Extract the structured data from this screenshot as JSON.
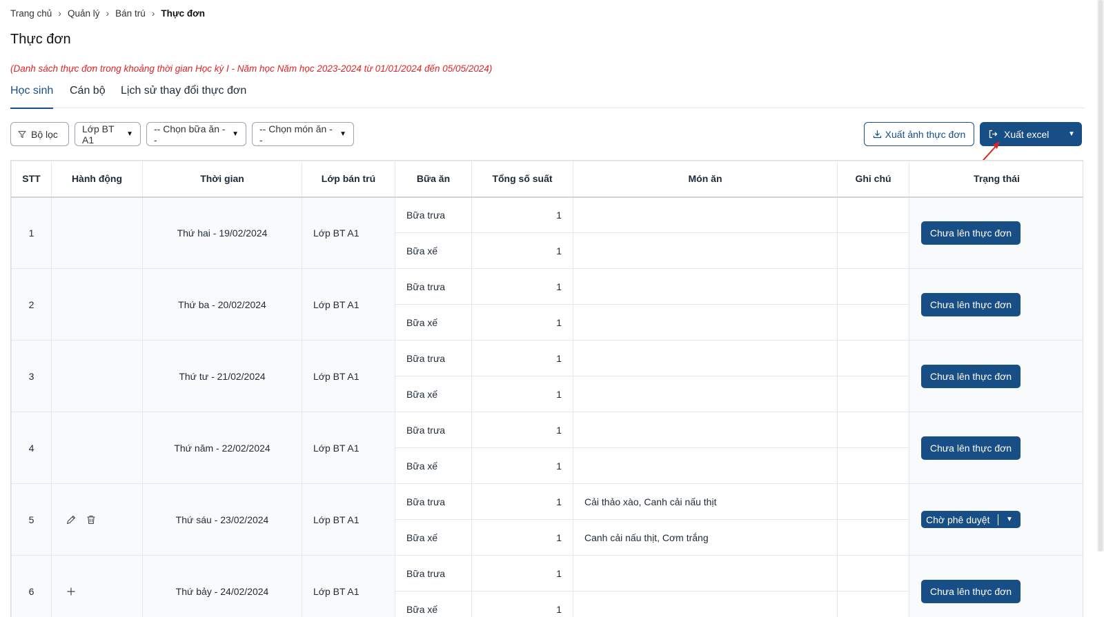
{
  "breadcrumb": [
    "Trang chủ",
    "Quản lý",
    "Bán trú",
    "Thực đơn"
  ],
  "page_title": "Thực đơn",
  "subtitle": "(Danh sách thực đơn trong khoảng thời gian Học kỳ I - Năm học Năm học 2023-2024 từ 01/01/2024 đến 05/05/2024)",
  "tabs": [
    "Học sinh",
    "Cán bộ",
    "Lịch sử thay đổi thực đơn"
  ],
  "filters": {
    "filter_label": "Bộ lọc",
    "class_select": "Lớp BT A1",
    "meal_select": "-- Chọn bữa ăn --",
    "dish_select": "-- Chọn món ăn --"
  },
  "toolbar": {
    "export_image": "Xuất ảnh thực đơn",
    "export_excel": "Xuất excel"
  },
  "colors": {
    "primary": "#184e86",
    "danger": "#e02424"
  },
  "table": {
    "headers": [
      "STT",
      "Hành động",
      "Thời gian",
      "Lớp bán trú",
      "Bữa ăn",
      "Tổng số suất",
      "Món ăn",
      "Ghi chú",
      "Trạng thái"
    ],
    "rows": [
      {
        "stt": "1",
        "time": "Thứ hai - 19/02/2024",
        "class": "Lớp BT A1",
        "actions": "",
        "meals": [
          {
            "name": "Bữa trưa",
            "qty": "1",
            "dish": ""
          },
          {
            "name": "Bữa xế",
            "qty": "1",
            "dish": ""
          }
        ],
        "status": "Chưa lên thực đơn"
      },
      {
        "stt": "2",
        "time": "Thứ ba - 20/02/2024",
        "class": "Lớp BT A1",
        "actions": "",
        "meals": [
          {
            "name": "Bữa trưa",
            "qty": "1",
            "dish": ""
          },
          {
            "name": "Bữa xế",
            "qty": "1",
            "dish": ""
          }
        ],
        "status": "Chưa lên thực đơn"
      },
      {
        "stt": "3",
        "time": "Thứ tư - 21/02/2024",
        "class": "Lớp BT A1",
        "actions": "",
        "meals": [
          {
            "name": "Bữa trưa",
            "qty": "1",
            "dish": ""
          },
          {
            "name": "Bữa xế",
            "qty": "1",
            "dish": ""
          }
        ],
        "status": "Chưa lên thực đơn"
      },
      {
        "stt": "4",
        "time": "Thứ năm - 22/02/2024",
        "class": "Lớp BT A1",
        "actions": "",
        "meals": [
          {
            "name": "Bữa trưa",
            "qty": "1",
            "dish": ""
          },
          {
            "name": "Bữa xế",
            "qty": "1",
            "dish": ""
          }
        ],
        "status": "Chưa lên thực đơn"
      },
      {
        "stt": "5",
        "time": "Thứ sáu - 23/02/2024",
        "class": "Lớp BT A1",
        "actions": "edit-delete",
        "meals": [
          {
            "name": "Bữa trưa",
            "qty": "1",
            "dish": "Cải thảo xào, Canh cải nấu thịt"
          },
          {
            "name": "Bữa xế",
            "qty": "1",
            "dish": "Canh cải nấu thịt, Cơm trắng"
          }
        ],
        "status": "Chờ phê duyệt"
      },
      {
        "stt": "6",
        "time": "Thứ bảy - 24/02/2024",
        "class": "Lớp BT A1",
        "actions": "add",
        "meals": [
          {
            "name": "Bữa trưa",
            "qty": "1",
            "dish": ""
          },
          {
            "name": "Bữa xế",
            "qty": "1",
            "dish": ""
          }
        ],
        "status": "Chưa lên thực đơn"
      }
    ]
  }
}
